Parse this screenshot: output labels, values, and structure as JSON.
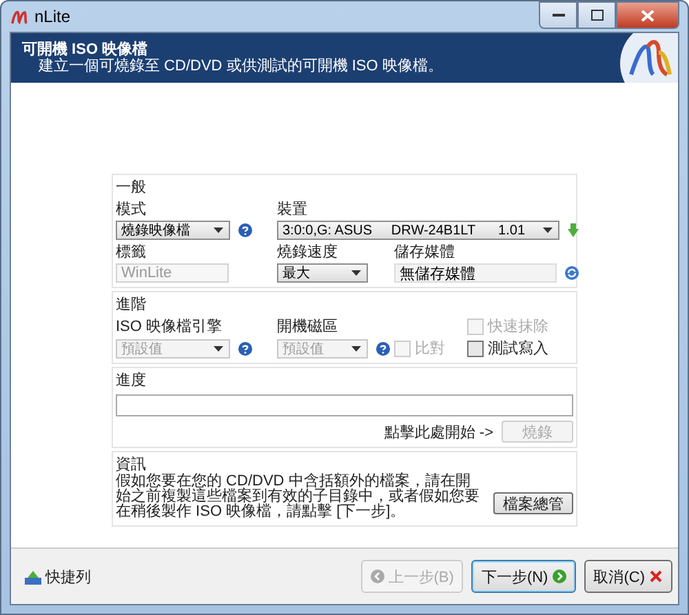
{
  "window": {
    "title": "nLite"
  },
  "header": {
    "title": "可開機 ISO 映像檔",
    "subtitle": "建立一個可燒錄至 CD/DVD 或供測試的可開機 ISO 映像檔。"
  },
  "general": {
    "label": "一般",
    "mode": {
      "label": "模式",
      "value": "燒錄映像檔"
    },
    "device": {
      "label": "裝置",
      "value": "3:0:0,G: ASUS     DRW-24B1LT      1.01"
    },
    "tag": {
      "label": "標籤",
      "value": "WinLite",
      "disabled": true
    },
    "speed": {
      "label": "燒錄速度",
      "value": "最大"
    },
    "media": {
      "label": "儲存媒體",
      "value": "無儲存媒體"
    }
  },
  "advanced": {
    "label": "進階",
    "engine": {
      "label": "ISO 映像檔引擎",
      "value": "預設值",
      "disabled": true
    },
    "boot": {
      "label": "開機磁區",
      "value": "預設值",
      "disabled": true
    },
    "checkboxes": [
      {
        "label": "快速抹除",
        "checked": false,
        "disabled": true
      },
      {
        "label": "比對",
        "checked": false,
        "disabled": true
      },
      {
        "label": "測試寫入",
        "checked": false,
        "disabled": false
      }
    ]
  },
  "progress": {
    "label": "進度",
    "level": 0,
    "hint": "點擊此處開始 ->",
    "button": {
      "label": "燒錄",
      "disabled": true
    }
  },
  "info": {
    "label": "資訊",
    "text": "假如您要在您的 CD/DVD 中含括額外的檔案，請在開始之前複製這些檔案到有效的子目錄中，或者假如您要在稍後製作 ISO 映像檔，請點擊 [下一步]。",
    "button": "檔案總管"
  },
  "footer": {
    "shortcut": "快捷列",
    "buttons": [
      {
        "kind": "back",
        "label": "上一步(B)",
        "disabled": true
      },
      {
        "kind": "next",
        "label": "下一步(N)",
        "disabled": false
      },
      {
        "kind": "cancel",
        "label": "取消(C)",
        "disabled": false
      }
    ]
  }
}
